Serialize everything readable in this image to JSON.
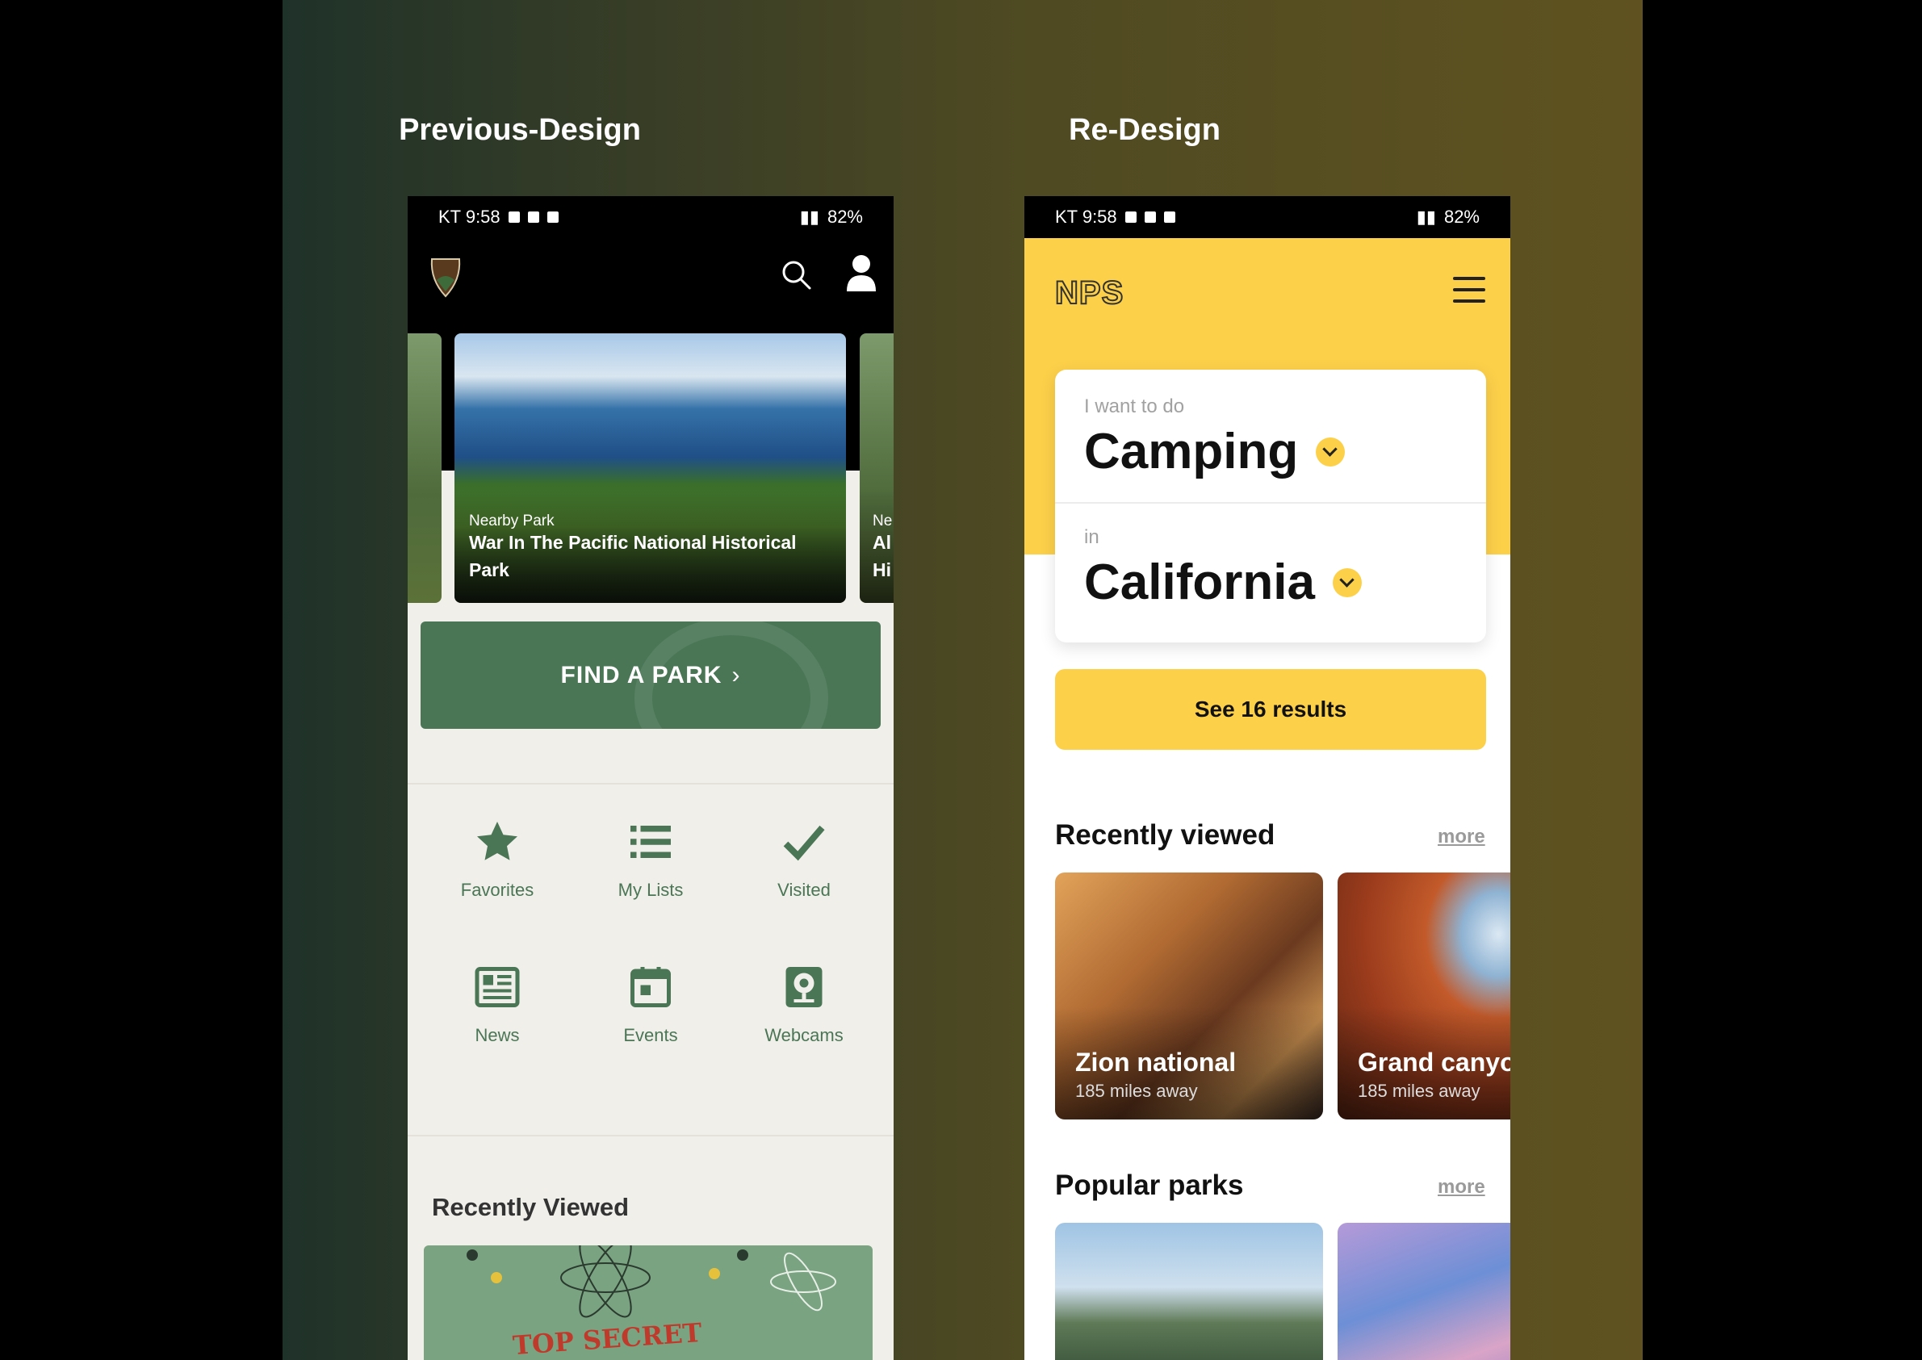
{
  "headings": {
    "previous": "Previous-Design",
    "redesign": "Re-Design"
  },
  "status_bar": {
    "time": "KT 9:58",
    "battery": "82%"
  },
  "old_app": {
    "carousel": {
      "main_card": {
        "subtitle": "Nearby Park",
        "title": "War In The Pacific National Historical Park"
      },
      "next_card": {
        "subtitle": "Ne",
        "title": "Al Hi"
      }
    },
    "find_park_label": "FIND A PARK",
    "grid": [
      {
        "label": "Favorites",
        "icon": "star-icon"
      },
      {
        "label": "My Lists",
        "icon": "list-icon"
      },
      {
        "label": "Visited",
        "icon": "check-icon"
      },
      {
        "label": "News",
        "icon": "newspaper-icon"
      },
      {
        "label": "Events",
        "icon": "calendar-icon"
      },
      {
        "label": "Webcams",
        "icon": "webcam-icon"
      }
    ],
    "recently_viewed_title": "Recently Viewed",
    "recent_card_text": "TOP SECRET"
  },
  "new_app": {
    "logo": "NPS",
    "picker": {
      "activity_label": "I want to do",
      "activity_value": "Camping",
      "location_label": "in",
      "location_value": "California"
    },
    "results_button": "See 16 results",
    "recently_viewed": {
      "title": "Recently viewed",
      "more": "more",
      "items": [
        {
          "name": "Zion national",
          "distance": "185 miles away"
        },
        {
          "name": "Grand canyon",
          "distance": "185 miles away"
        }
      ]
    },
    "popular_parks": {
      "title": "Popular parks",
      "more": "more"
    }
  },
  "colors": {
    "nps_yellow": "#fdd04a",
    "nps_green": "#4a7656"
  }
}
